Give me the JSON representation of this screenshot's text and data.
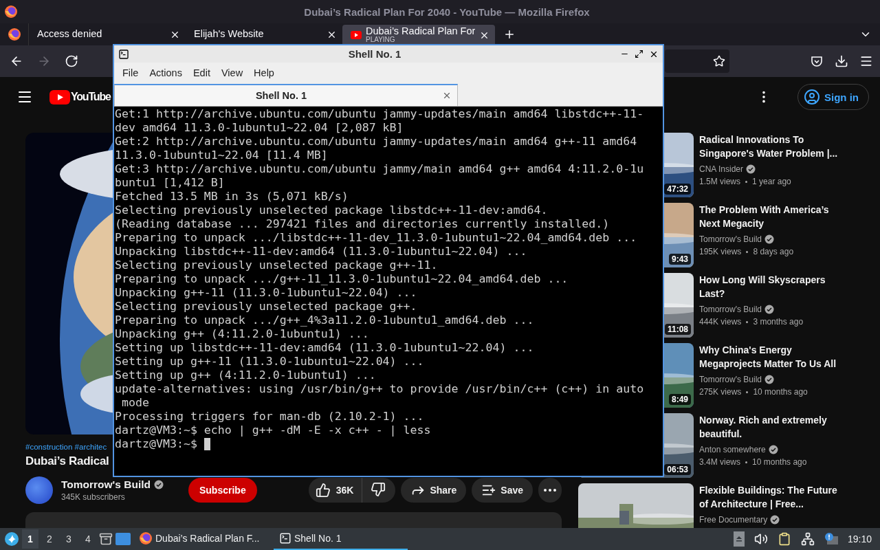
{
  "window": {
    "title": "Dubai’s Radical Plan For 2040 - YouTube — Mozilla Firefox"
  },
  "tabs": [
    {
      "label": "Access denied",
      "selected": false
    },
    {
      "label": "Elijah's Website",
      "selected": false
    },
    {
      "label": "Dubai’s Radical Plan For",
      "sublabel": "PLAYING",
      "selected": true
    }
  ],
  "nav": [
    {
      "kind": "back",
      "disabled": false
    },
    {
      "kind": "forward",
      "disabled": true
    },
    {
      "kind": "reload",
      "disabled": false
    }
  ],
  "youtube": {
    "logo": "YouTube",
    "sign_in": "Sign in",
    "video": {
      "hashtags": "#construction #architec",
      "title": "Dubai’s Radical",
      "channel": "Tomorrow's Build",
      "subscribers": "345K subscribers",
      "subscribe": "Subscribe",
      "likes": "36K",
      "share": "Share",
      "save": "Save"
    },
    "sidebar": [
      {
        "title": "Radical Innovations To Singapore's Water Problem |...",
        "channel": "CNA Insider",
        "views": "1.5M views",
        "age": "1 year ago",
        "duration": "47:32"
      },
      {
        "title": "The Problem With America’s Next Megacity",
        "channel": "Tomorrow's Build",
        "views": "195K views",
        "age": "8 days ago",
        "duration": "9:43"
      },
      {
        "title": "How Long Will Skyscrapers Last?",
        "channel": "Tomorrow's Build",
        "views": "444K views",
        "age": "3 months ago",
        "duration": "11:08"
      },
      {
        "title": "Why China's Energy Megaprojects Matter To Us All",
        "channel": "Tomorrow's Build",
        "views": "275K views",
        "age": "10 months ago",
        "duration": "8:49"
      },
      {
        "title": "Norway. Rich and extremely beautiful.",
        "channel": "Anton somewhere",
        "views": "3.4M views",
        "age": "10 months ago",
        "duration": "06:53"
      },
      {
        "title": "Flexible Buildings: The Future of Architecture | Free...",
        "channel": "Free Documentary"
      }
    ]
  },
  "terminal": {
    "title": "Shell No. 1",
    "menu": [
      "File",
      "Actions",
      "Edit",
      "View",
      "Help"
    ],
    "tab": "Shell No. 1",
    "lines": [
      "Get:1 http://archive.ubuntu.com/ubuntu jammy-updates/main amd64 libstdc++-11-",
      "dev amd64 11.3.0-1ubuntu1~22.04 [2,087 kB]",
      "Get:2 http://archive.ubuntu.com/ubuntu jammy-updates/main amd64 g++-11 amd64",
      "11.3.0-1ubuntu1~22.04 [11.4 MB]",
      "Get:3 http://archive.ubuntu.com/ubuntu jammy/main amd64 g++ amd64 4:11.2.0-1u",
      "buntu1 [1,412 B]",
      "Fetched 13.5 MB in 3s (5,071 kB/s)",
      "Selecting previously unselected package libstdc++-11-dev:amd64.",
      "(Reading database ... 297421 files and directories currently installed.)",
      "Preparing to unpack .../libstdc++-11-dev_11.3.0-1ubuntu1~22.04_amd64.deb ...",
      "Unpacking libstdc++-11-dev:amd64 (11.3.0-1ubuntu1~22.04) ...",
      "Selecting previously unselected package g++-11.",
      "Preparing to unpack .../g++-11_11.3.0-1ubuntu1~22.04_amd64.deb ...",
      "Unpacking g++-11 (11.3.0-1ubuntu1~22.04) ...",
      "Selecting previously unselected package g++.",
      "Preparing to unpack .../g++_4%3a11.2.0-1ubuntu1_amd64.deb ...",
      "Unpacking g++ (4:11.2.0-1ubuntu1) ...",
      "Setting up libstdc++-11-dev:amd64 (11.3.0-1ubuntu1~22.04) ...",
      "Setting up g++-11 (11.3.0-1ubuntu1~22.04) ...",
      "Setting up g++ (4:11.2.0-1ubuntu1) ...",
      "update-alternatives: using /usr/bin/g++ to provide /usr/bin/c++ (c++) in auto",
      " mode",
      "Processing triggers for man-db (2.10.2-1) ...",
      "dartz@VM3:~$ echo | g++ -dM -E -x c++ - | less",
      "dartz@VM3:~$"
    ]
  },
  "taskbar": {
    "workspaces": [
      {
        "label": "1",
        "selected": true
      },
      {
        "label": "2",
        "selected": false
      },
      {
        "label": "3",
        "selected": false
      },
      {
        "label": "4",
        "selected": false
      }
    ],
    "tasks": [
      {
        "kind": "browser",
        "label": "Dubai’s Radical Plan F...",
        "selected": false
      },
      {
        "kind": "terminal",
        "label": "Shell No. 1",
        "selected": true
      }
    ],
    "clock": "19:10"
  }
}
